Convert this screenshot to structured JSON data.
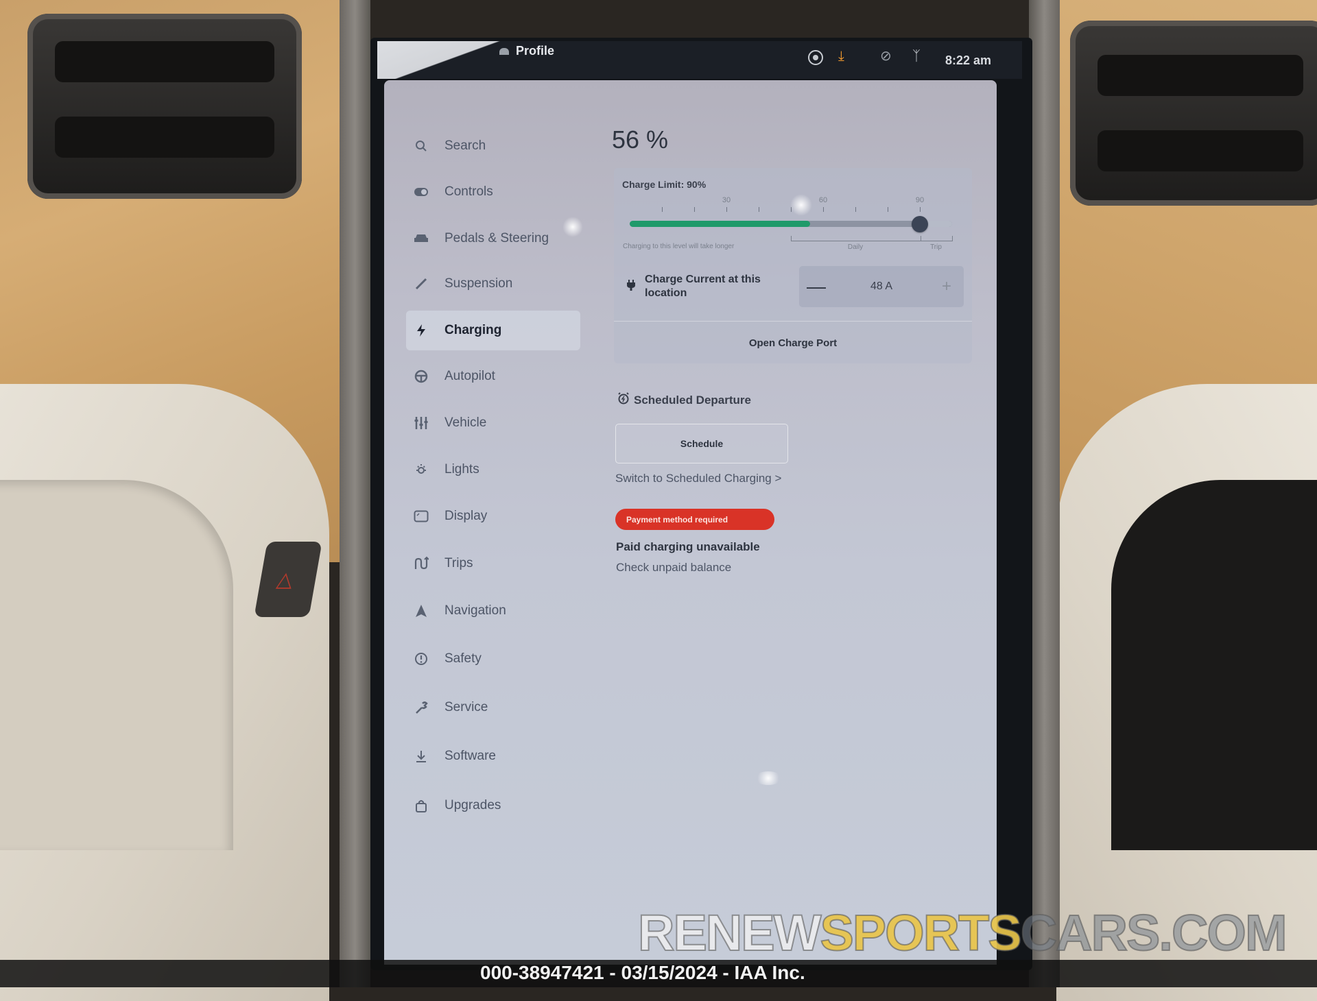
{
  "topbar": {
    "profile_label": "Profile",
    "clock": "8:22 am",
    "icons": [
      "camera-icon",
      "download-icon",
      "no-signal-icon",
      "bluetooth-icon"
    ],
    "download_icon_color": "#f29a2e"
  },
  "sidebar": {
    "items": [
      {
        "label": "Search",
        "icon": "search-icon",
        "active": false
      },
      {
        "label": "Controls",
        "icon": "toggle-icon",
        "active": false
      },
      {
        "label": "Pedals & Steering",
        "icon": "car-icon",
        "active": false
      },
      {
        "label": "Suspension",
        "icon": "suspension-icon",
        "active": false
      },
      {
        "label": "Charging",
        "icon": "lightning-icon",
        "active": true
      },
      {
        "label": "Autopilot",
        "icon": "steering-wheel-icon",
        "active": false
      },
      {
        "label": "Vehicle",
        "icon": "sliders-icon",
        "active": false
      },
      {
        "label": "Lights",
        "icon": "light-icon",
        "active": false
      },
      {
        "label": "Display",
        "icon": "display-icon",
        "active": false
      },
      {
        "label": "Trips",
        "icon": "trips-icon",
        "active": false
      },
      {
        "label": "Navigation",
        "icon": "navigation-arrow-icon",
        "active": false
      },
      {
        "label": "Safety",
        "icon": "alert-circle-icon",
        "active": false
      },
      {
        "label": "Service",
        "icon": "wrench-icon",
        "active": false
      },
      {
        "label": "Software",
        "icon": "download-icon",
        "active": false
      },
      {
        "label": "Upgrades",
        "icon": "shopping-bag-icon",
        "active": false
      }
    ]
  },
  "charging": {
    "battery_percent_label": "56 %",
    "battery_level_percent": 56,
    "charge_limit_label": "Charge Limit: 90%",
    "charge_limit_percent": 90,
    "slider_min": 0,
    "slider_max": 100,
    "tick_labels": [
      "30",
      "60",
      "90"
    ],
    "hint": "Charging to this level will take longer",
    "range_labels": {
      "daily": "Daily",
      "trip": "Trip"
    },
    "charge_current_label": "Charge Current at this location",
    "charge_current_value": "48 A",
    "minus_label": "—",
    "plus_label": "+",
    "open_charge_port_label": "Open Charge Port",
    "scheduled_departure_label": "Scheduled Departure",
    "schedule_button_label": "Schedule",
    "switch_link_label": "Switch to Scheduled Charging >",
    "payment_badge_label": "Payment method required",
    "paid_charging_label": "Paid charging unavailable",
    "check_balance_label": "Check unpaid balance",
    "fill_color": "#1f9a6a",
    "badge_color": "#d93327"
  },
  "watermark": {
    "part1": "RENEW",
    "part2": "SPORTS",
    "part3": "CARS.COM"
  },
  "footer": {
    "text": "000-38947421 - 03/15/2024 - IAA Inc."
  }
}
